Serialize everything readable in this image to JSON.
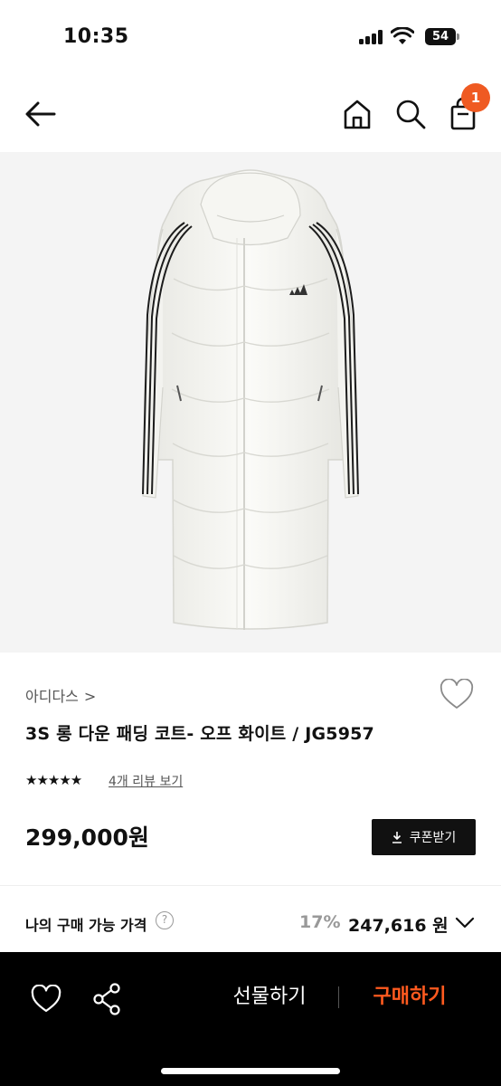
{
  "status_bar": {
    "time": "10:35",
    "battery": "54"
  },
  "header": {
    "icons": [
      "back-arrow-icon",
      "home-icon",
      "search-icon",
      "shopping-bag-icon"
    ],
    "cart_badge_count": "1",
    "badge_color": "#ef5a22"
  },
  "product": {
    "brand": "아디다스",
    "brand_chevron": ">",
    "title": "3S 롱 다운 패딩 코트- 오프 화이트 / JG5957",
    "rating_stars": 5,
    "stars_text": "★★★★★",
    "review_link": "4개 리뷰 보기",
    "price": "299,000원",
    "coupon_label": "쿠폰받기"
  },
  "my_price": {
    "label": "나의 구매 가능 가격",
    "help": "?",
    "discount_rate": "17%",
    "discounted_price": "247,616 원"
  },
  "bottom_bar": {
    "gift_label": "선물하기",
    "buy_label": "구매하기",
    "buy_color": "#ff5a1f"
  }
}
